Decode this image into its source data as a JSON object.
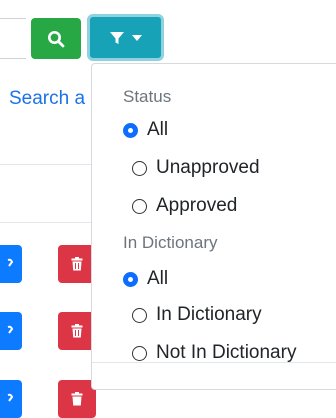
{
  "search_link": "Search a",
  "filter_menu": {
    "status_header": "Status",
    "status_options": [
      "All",
      "Unapproved",
      "Approved"
    ],
    "dictionary_header": "In Dictionary",
    "dictionary_options": [
      "All",
      "In Dictionary",
      "Not In Dictionary"
    ],
    "selected_status": "All",
    "selected_dictionary": "All"
  },
  "icons": {
    "search_button": "search-icon",
    "filter_button": "filter-icon",
    "edit_button": "wrench-icon",
    "delete_button": "trash-icon"
  },
  "colors": {
    "search_button": "#28a745",
    "filter_button": "#17a2b8",
    "edit_button": "#0d7bff",
    "delete_button": "#dc3545",
    "link": "#1a73e8",
    "radio_checked": "#0d6efd"
  }
}
